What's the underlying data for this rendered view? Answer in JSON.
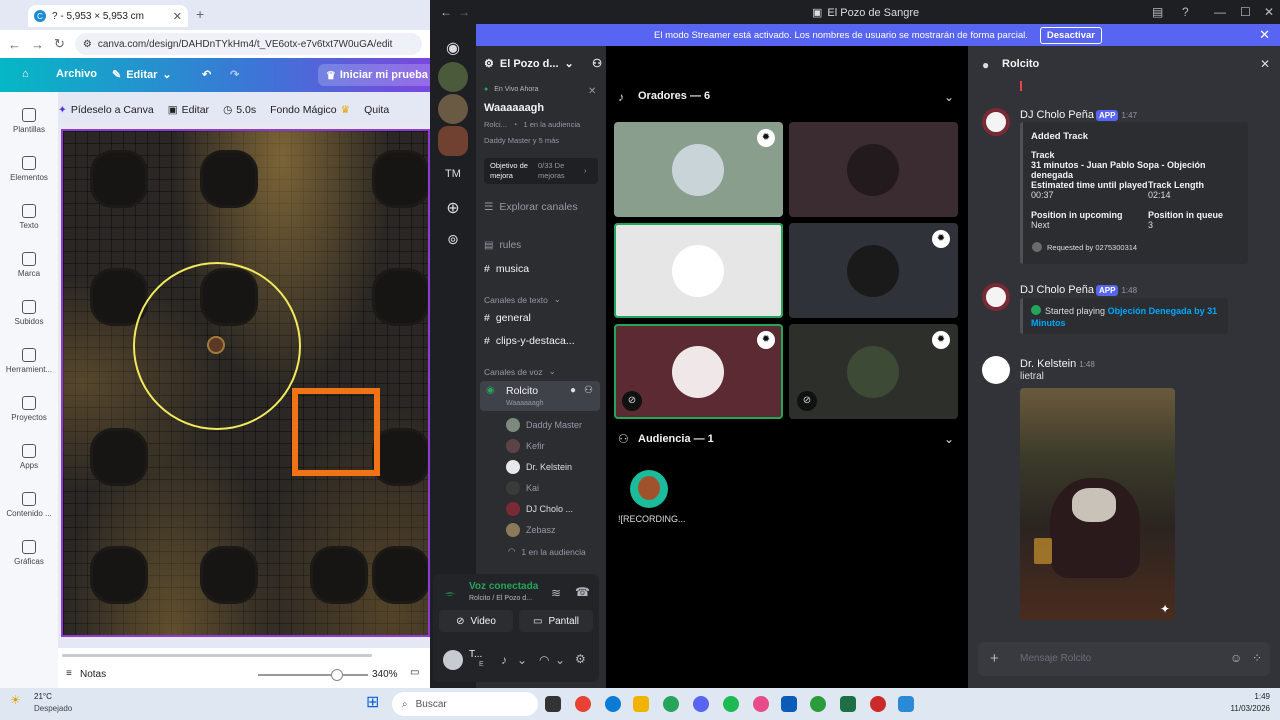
{
  "browser": {
    "tab_title": "? - 5,953 × 5,953 cm",
    "url": "canva.com/design/DAHDnTYkHm4/t_VE6otx-e7v6txt7W0uGA/edit"
  },
  "canva": {
    "menu_file": "Archivo",
    "menu_edit": "Editar",
    "trial_button": "Iniciar mi prueba gr",
    "toolbar": {
      "ask": "Pídeselo a Canva",
      "edit": "Editar",
      "duration": "5.0s",
      "magic_bg": "Fondo Mágico",
      "remove": "Quita"
    },
    "sidebar": [
      "Plantillas",
      "Elementos",
      "Texto",
      "Marca",
      "Subidos",
      "Herramient...",
      "Proyectos",
      "Apps",
      "Contenido ...",
      "Gráficas"
    ],
    "notes": "Notas",
    "zoom": "340%",
    "zoom_value": 0.72
  },
  "discord": {
    "window_title": "El Pozo de Sangre",
    "streamer_banner": "El modo Streamer está activado. Los nombres de usuario se mostrarán de forma parcial.",
    "deactivate": "Desactivar",
    "server_initials": "TM",
    "server_name": "El Pozo d...",
    "live": {
      "status": "En Vivo Ahora",
      "title": "Waaaaaagh",
      "meta1_user": "Rolci...",
      "meta1_audience": "1 en la audiencia",
      "meta2": "Daddy Master y 5 más"
    },
    "goal": {
      "label": "Objetivo de mejora",
      "value": "0/33 De mejoras"
    },
    "explore": "Explorar canales",
    "channels": {
      "rules": "rules",
      "music": "musica",
      "text_category": "Canales de texto",
      "general": "general",
      "clips": "clips-y-destaca...",
      "voice_category": "Canales de voz",
      "voice_channel": "Rolcito",
      "voice_subtitle": "Waaaaaagh",
      "members": [
        "Daddy Master",
        "Kefir",
        "Dr. Kelstein",
        "Kai",
        "DJ Cholo ...",
        "Zebasz"
      ],
      "audience_count": "1 en la audiencia"
    },
    "voice_status": {
      "title": "Voz conectada",
      "subtitle": "Rolcito / El Pozo d..."
    },
    "buttons": {
      "video": "Video",
      "screen": "Pantall"
    },
    "user": {
      "name": "T...",
      "sub": "E"
    },
    "stage": {
      "speakers_header": "Oradores — 6",
      "audience_header": "Audiencia — 1",
      "audience_member": "![RECORDING...",
      "tiles": [
        {
          "bg": "#8a9e8e",
          "avatar": "#c9d4d8",
          "badge": true,
          "mute": false,
          "speaking": false
        },
        {
          "bg": "#3a2c30",
          "avatar": "#221a1c",
          "badge": false,
          "mute": false,
          "speaking": false
        },
        {
          "bg": "#e6e6e6",
          "avatar": "#ffffff",
          "badge": false,
          "mute": false,
          "speaking": true
        },
        {
          "bg": "#2f3238",
          "avatar": "#1a1a1a",
          "badge": true,
          "mute": false,
          "speaking": false
        },
        {
          "bg": "#5b2a33",
          "avatar": "#f0e8e8",
          "badge": true,
          "mute": true,
          "speaking": true
        },
        {
          "bg": "#2d2f2a",
          "avatar": "#3d4a35",
          "badge": true,
          "mute": true,
          "speaking": false
        }
      ]
    },
    "chat": {
      "channel": "Rolcito",
      "messages": [
        {
          "author": "DJ Cholo Peña",
          "app": "APP",
          "time": "1:47",
          "embed_title": "Added Track",
          "track_label": "Track",
          "track": "31 minutos - Juan Pablo Sopa - Objeción denegada",
          "est_label": "Estimated time until played",
          "est": "00:37",
          "len_label": "Track Length",
          "len": "02:14",
          "pos_up_label": "Position in upcoming",
          "pos_up": "Next",
          "pos_q_label": "Position in queue",
          "pos_q": "3",
          "requested": "Requested by 0275300314"
        },
        {
          "author": "DJ Cholo Peña",
          "app": "APP",
          "time": "1:48",
          "started": "Started playing",
          "song": "Objeción Denegada by 31 Minutos"
        },
        {
          "author": "Dr. Kelstein",
          "time": "1:48",
          "text": "lietral"
        }
      ],
      "input_placeholder": "Mensaje Rolcito"
    }
  },
  "taskbar": {
    "temp": "21°C",
    "weather": "Despejado",
    "search": "Buscar",
    "time": "1:49",
    "date": "11/03/2026"
  }
}
